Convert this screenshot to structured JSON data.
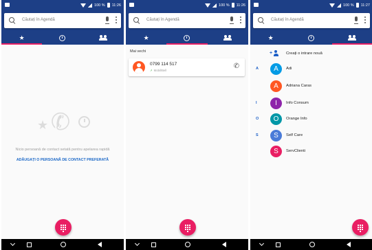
{
  "status": {
    "battery": "100 %",
    "time1": "11:26",
    "time2": "11:26",
    "time3": "11:27"
  },
  "search": {
    "placeholder": "Căutați în Agendă"
  },
  "colors": {
    "primary": "#1d3f86",
    "accent": "#e91e63",
    "link": "#1a67c7"
  },
  "tabs": [
    {
      "icon": "star-icon"
    },
    {
      "icon": "clock-icon"
    },
    {
      "icon": "people-icon"
    }
  ],
  "favorites": {
    "empty_message": "Nicio persoană de contact setată pentru apelarea rapidă",
    "add_link": "ADĂUGAȚI O PERSOANĂ DE CONTACT PREFERATĂ"
  },
  "recents": {
    "section_label": "Mai vechi",
    "call": {
      "number": "0799 114 517",
      "sub": "Mobil/Bell"
    }
  },
  "contacts": {
    "create_label": "Creați o intrare nouă",
    "items": [
      {
        "letter": "A",
        "initial": "A",
        "name": "Adi",
        "color": "#039be5"
      },
      {
        "letter": "",
        "initial": "A",
        "name": "Adriana Caras",
        "color": "#ff5722"
      },
      {
        "letter": "I",
        "initial": "I",
        "name": "Info Consum",
        "color": "#8e24aa"
      },
      {
        "letter": "O",
        "initial": "O",
        "name": "Orange Info",
        "color": "#0097a7"
      },
      {
        "letter": "S",
        "initial": "S",
        "name": "Self Care",
        "color": "#4a7bd8"
      },
      {
        "letter": "",
        "initial": "S",
        "name": "ServClienti",
        "color": "#e91e63"
      }
    ]
  }
}
